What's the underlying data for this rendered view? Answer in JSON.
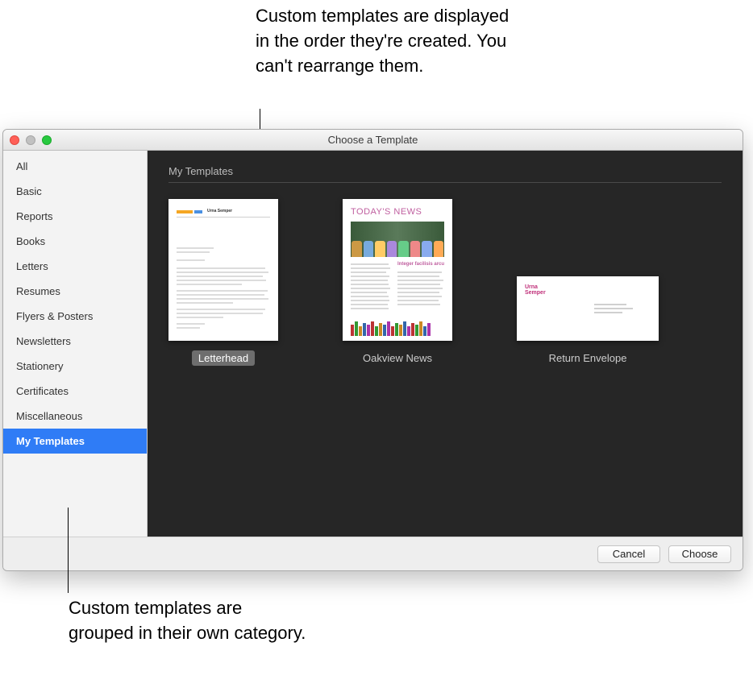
{
  "annotations": {
    "top": "Custom templates are displayed in the order they're created. You can't rearrange them.",
    "bottom": "Custom templates are grouped in their own category."
  },
  "window": {
    "title": "Choose a Template"
  },
  "sidebar": {
    "items": [
      {
        "label": "All",
        "active": false
      },
      {
        "label": "Basic",
        "active": false
      },
      {
        "label": "Reports",
        "active": false
      },
      {
        "label": "Books",
        "active": false
      },
      {
        "label": "Letters",
        "active": false
      },
      {
        "label": "Resumes",
        "active": false
      },
      {
        "label": "Flyers & Posters",
        "active": false
      },
      {
        "label": "Newsletters",
        "active": false
      },
      {
        "label": "Stationery",
        "active": false
      },
      {
        "label": "Certificates",
        "active": false
      },
      {
        "label": "Miscellaneous",
        "active": false
      },
      {
        "label": "My Templates",
        "active": true
      }
    ]
  },
  "main": {
    "section_header": "My Templates",
    "templates": [
      {
        "label": "Letterhead",
        "selected": true
      },
      {
        "label": "Oakview News",
        "selected": false
      },
      {
        "label": "Return Envelope",
        "selected": false
      }
    ],
    "thumb_text": {
      "letterhead_name": "Urna Semper",
      "news_title": "TODAY'S NEWS",
      "news_sub": "Integer facilisis arcu",
      "env_name1": "Urna",
      "env_name2": "Semper"
    }
  },
  "footer": {
    "cancel": "Cancel",
    "choose": "Choose"
  }
}
